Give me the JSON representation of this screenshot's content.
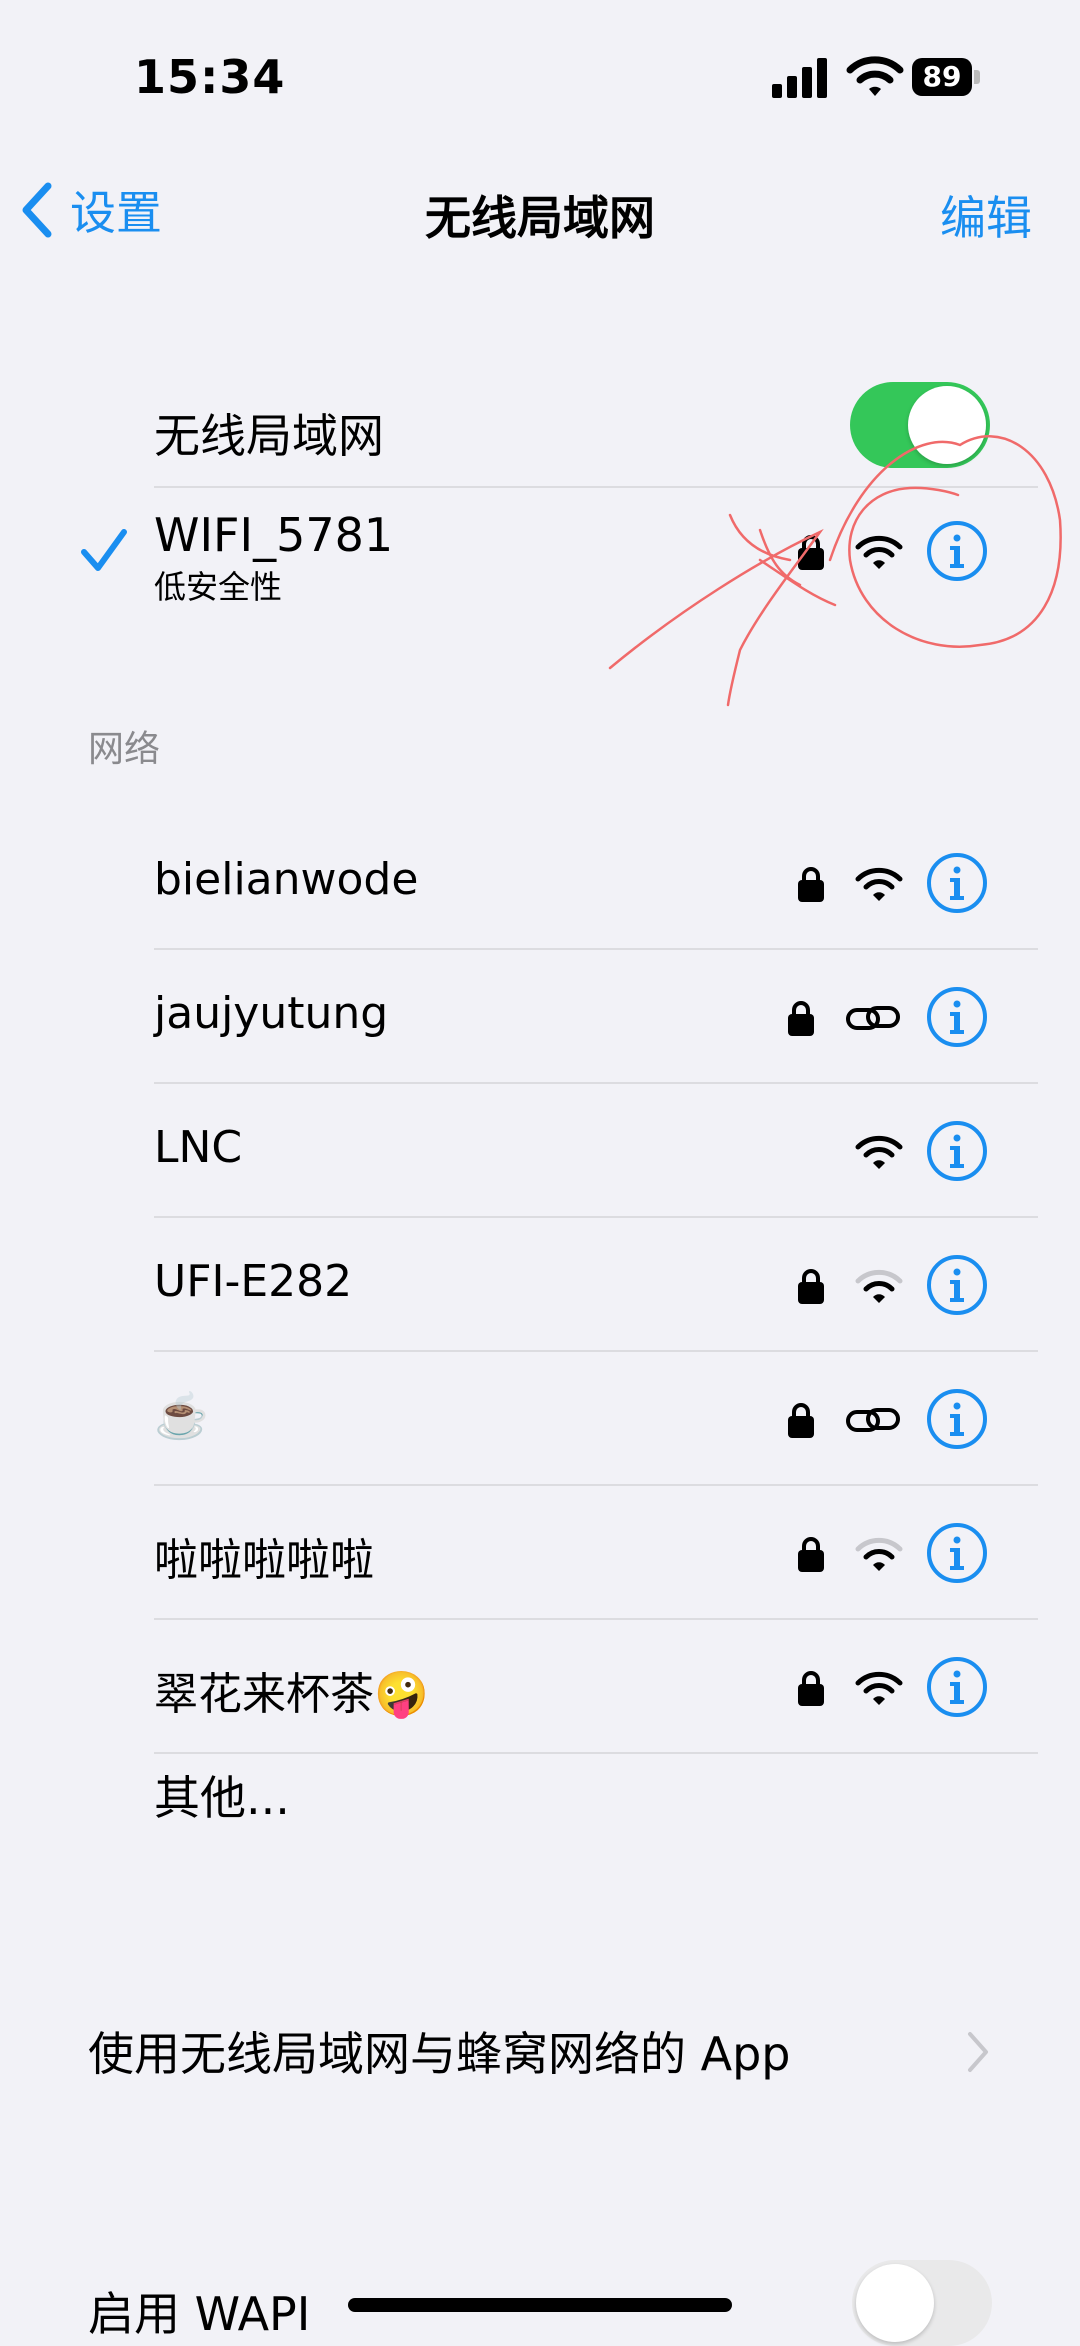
{
  "status_bar": {
    "time": "15:34",
    "battery": "89"
  },
  "nav": {
    "back_label": "设置",
    "title": "无线局域网",
    "edit_label": "编辑"
  },
  "wifi_toggle": {
    "label": "无线局域网",
    "on": true
  },
  "connected": {
    "name": "WIFI_5781",
    "subtitle": "低安全性",
    "locked": true,
    "icon": "wifi-icon"
  },
  "section_header": "网络",
  "networks": [
    {
      "name": "bielianwode",
      "locked": true,
      "icon": "wifi-icon",
      "strength": "full"
    },
    {
      "name": "jaujyutung",
      "locked": true,
      "icon": "link-icon"
    },
    {
      "name": "LNC",
      "locked": false,
      "icon": "wifi-icon",
      "strength": "full"
    },
    {
      "name": "UFI-E282",
      "locked": true,
      "icon": "wifi-icon",
      "strength": "weak"
    },
    {
      "name": "☕️",
      "locked": true,
      "icon": "link-icon"
    },
    {
      "name": "啦啦啦啦啦",
      "locked": true,
      "icon": "wifi-icon",
      "strength": "weak"
    },
    {
      "name": "翠花来杯茶🤪",
      "locked": true,
      "icon": "wifi-icon",
      "strength": "full"
    }
  ],
  "other_label": "其他...",
  "apps_label": "使用无线局域网与蜂窝网络的 App",
  "wapi_label": "启用 WAPI",
  "colors": {
    "accent": "#1a8ef0",
    "toggle_on": "#34c759",
    "annotation": "#f06a6a"
  }
}
